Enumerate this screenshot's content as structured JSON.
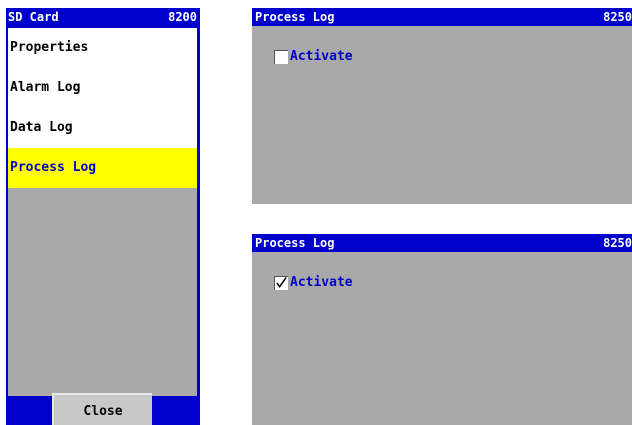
{
  "sd_panel": {
    "title": "SD Card",
    "code": "8200",
    "menu": [
      {
        "label": "Properties",
        "selected": false
      },
      {
        "label": "Alarm Log",
        "selected": false
      },
      {
        "label": "Data Log",
        "selected": false
      },
      {
        "label": "Process Log",
        "selected": true
      }
    ],
    "close_label": "Close"
  },
  "dialog_unchecked": {
    "title": "Process Log",
    "code": "8250",
    "checkbox_label": "Activate",
    "checked": false
  },
  "dialog_checked": {
    "title": "Process Log",
    "code": "8250",
    "checkbox_label": "Activate",
    "checked": true
  },
  "colors": {
    "title_bar": "#0000cc",
    "panel_gray": "#a9a9a9",
    "highlight": "#ffff00",
    "label_blue": "#0000cc"
  }
}
